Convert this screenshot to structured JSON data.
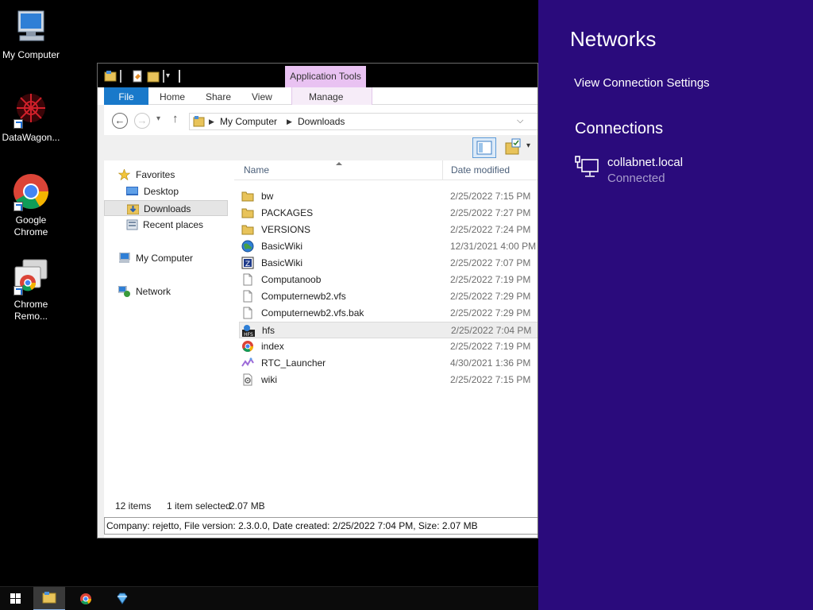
{
  "desktop": {
    "icons": [
      {
        "label": "My Computer"
      },
      {
        "label": "DataWagon..."
      },
      {
        "label_line1": "Google",
        "label_line2": "Chrome"
      },
      {
        "label_line1": "Chrome",
        "label_line2": "Remo..."
      }
    ]
  },
  "explorer": {
    "context_tab": "Application Tools",
    "ribbon_tabs": {
      "file": "File",
      "home": "Home",
      "share": "Share",
      "view": "View",
      "manage": "Manage"
    },
    "address": {
      "root": "My Computer",
      "folder": "Downloads"
    },
    "nav": {
      "favorites": "Favorites",
      "desktop": "Desktop",
      "downloads": "Downloads",
      "recent": "Recent places",
      "computer": "My Computer",
      "network": "Network"
    },
    "columns": {
      "name": "Name",
      "date": "Date modified"
    },
    "files": [
      {
        "name": "bw",
        "date": "2/25/2022 7:15 PM",
        "icon": "folder-icon"
      },
      {
        "name": "PACKAGES",
        "date": "2/25/2022 7:27 PM",
        "icon": "folder-icon"
      },
      {
        "name": "VERSIONS",
        "date": "2/25/2022 7:24 PM",
        "icon": "folder-icon"
      },
      {
        "name": "BasicWiki",
        "date": "12/31/2021 4:00 PM",
        "icon": "globe-icon"
      },
      {
        "name": "BasicWiki",
        "date": "2/25/2022 7:07 PM",
        "icon": "archive-icon"
      },
      {
        "name": "Computanoob",
        "date": "2/25/2022 7:19 PM",
        "icon": "file-icon"
      },
      {
        "name": "Computernewb2.vfs",
        "date": "2/25/2022 7:29 PM",
        "icon": "file-icon"
      },
      {
        "name": "Computernewb2.vfs.bak",
        "date": "2/25/2022 7:29 PM",
        "icon": "file-icon"
      },
      {
        "name": "hfs",
        "date": "2/25/2022 7:04 PM",
        "icon": "hfs-icon"
      },
      {
        "name": "index",
        "date": "2/25/2022 7:19 PM",
        "icon": "chrome-icon"
      },
      {
        "name": "RTC_Launcher",
        "date": "4/30/2021 1:36 PM",
        "icon": "shortcut-icon"
      },
      {
        "name": "wiki",
        "date": "2/25/2022 7:15 PM",
        "icon": "settings-file-icon"
      }
    ],
    "status": {
      "count": "12 items",
      "selected": "1 item selected",
      "size": "2.07 MB"
    },
    "details": "Company: rejetto, File version: 2.3.0.0, Date created: 2/25/2022 7:04 PM, Size: 2.07 MB"
  },
  "networks": {
    "title": "Networks",
    "view_settings": "View Connection Settings",
    "connections_heading": "Connections",
    "connection": {
      "name": "collabnet.local",
      "status": "Connected"
    }
  },
  "colors": {
    "charm_bg": "#2a0b7c",
    "file_tab": "#1979ca",
    "context_tab": "#e9c2f2"
  }
}
